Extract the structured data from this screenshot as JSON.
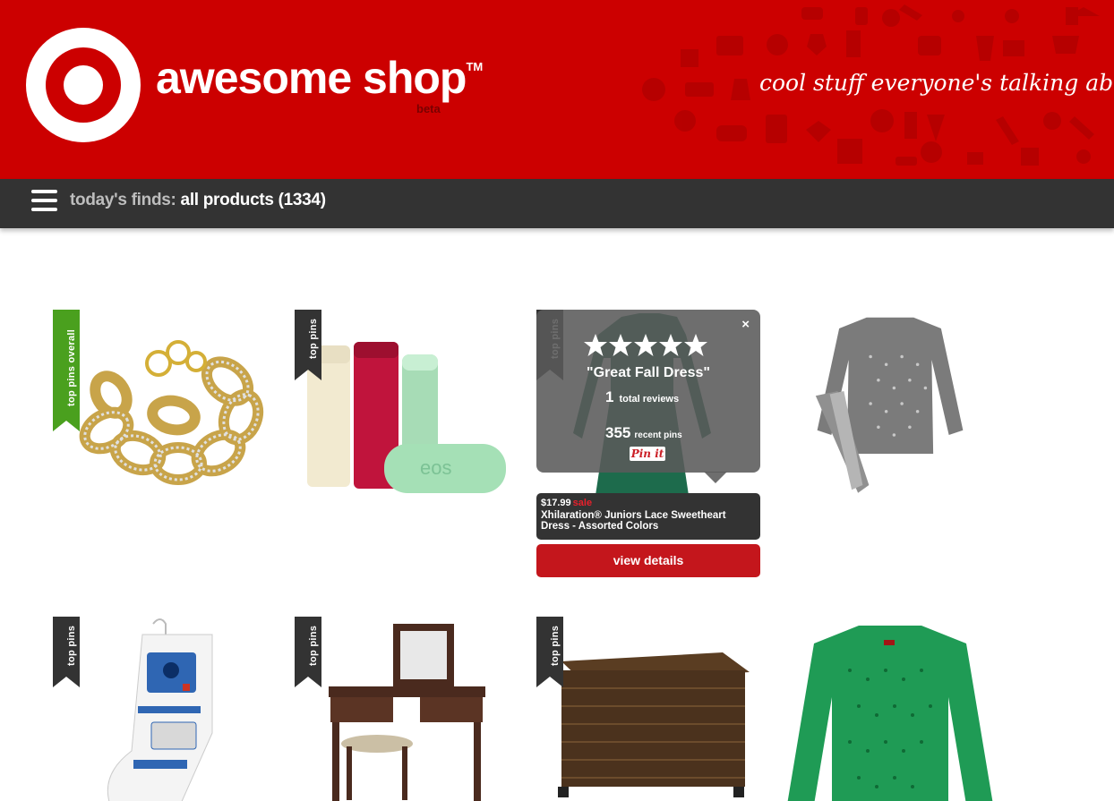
{
  "header": {
    "brand_name": "awesome shop",
    "trademark": "TM",
    "beta_label": "beta",
    "tagline": "cool stuff everyone's talking about"
  },
  "navbar": {
    "prefix": "today's finds:",
    "title": "all products (1334)"
  },
  "ribbons": {
    "top_pins_overall": "top pins overall",
    "top_pins": "top pins"
  },
  "products": [
    {
      "image": "gold-rhinestone-link-bracelet",
      "ribbon": "top pins overall"
    },
    {
      "image": "eos-lip-balm-sticks",
      "ribbon": "top pins"
    },
    {
      "image": "green-lace-dress",
      "ribbon": "top pins"
    },
    {
      "image": "gray-polka-dot-thermal-top",
      "ribbon": ""
    },
    {
      "image": "r2d2-christmas-stocking",
      "ribbon": "top pins"
    },
    {
      "image": "wood-vanity-desk-with-stool",
      "ribbon": "top pins"
    },
    {
      "image": "wicker-storage-trunk",
      "ribbon": "top pins"
    },
    {
      "image": "green-polka-dot-blouse",
      "ribbon": ""
    }
  ],
  "popup": {
    "rating_stars": 5,
    "review_title": "\"Great Fall Dress\"",
    "total_reviews": "1",
    "total_reviews_label": "total reviews",
    "recent_pins": "355",
    "recent_pins_label": "recent pins",
    "pinit_label": "Pin it",
    "close_label": "×"
  },
  "featured": {
    "price": "$17.99",
    "sale_label": "sale",
    "name": "Xhilaration® Juniors Lace Sweetheart Dress - Assorted Colors",
    "view_details_label": "view details"
  },
  "colors": {
    "brand_red": "#cc0000",
    "navbar": "#333333",
    "ribbon_green": "#4aa01e",
    "button_red": "#c4161c",
    "sale_red": "#e8202c"
  }
}
